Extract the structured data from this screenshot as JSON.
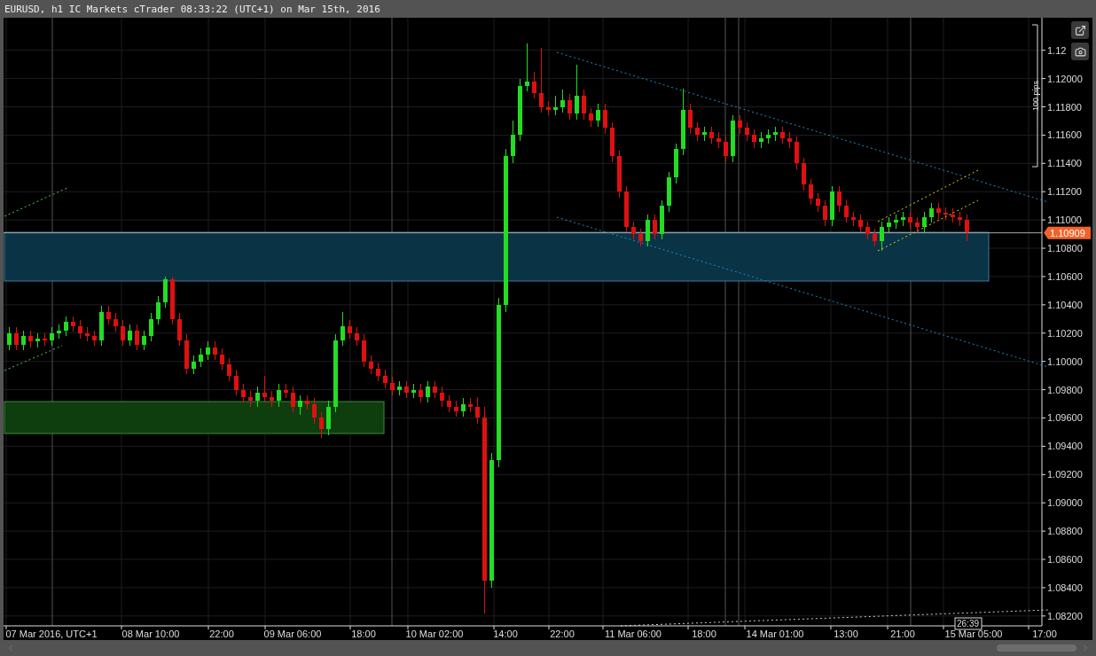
{
  "window": {
    "title": "EURUSD, h1 IC Markets cTrader 08:33:22 (UTC+1) on Mar 15th, 2016"
  },
  "current_price": "1.10909",
  "ruler": {
    "label": "100 pips"
  },
  "countdown": "26:39",
  "chart_data": {
    "type": "candlestick",
    "yticks": [
      {
        "value": 1.122,
        "label": "1.12"
      },
      {
        "value": 1.12,
        "label": "1.12000"
      },
      {
        "value": 1.118,
        "label": "1.11800"
      },
      {
        "value": 1.116,
        "label": "1.11600"
      },
      {
        "value": 1.114,
        "label": "1.11400"
      },
      {
        "value": 1.112,
        "label": "1.11200"
      },
      {
        "value": 1.11,
        "label": "1.11000"
      },
      {
        "value": 1.108,
        "label": "1.10800"
      },
      {
        "value": 1.106,
        "label": "1.10600"
      },
      {
        "value": 1.104,
        "label": "1.10400"
      },
      {
        "value": 1.102,
        "label": "1.10200"
      },
      {
        "value": 1.1,
        "label": "1.10000"
      },
      {
        "value": 1.098,
        "label": "1.09800"
      },
      {
        "value": 1.096,
        "label": "1.09600"
      },
      {
        "value": 1.094,
        "label": "1.09400"
      },
      {
        "value": 1.092,
        "label": "1.09200"
      },
      {
        "value": 1.09,
        "label": "1.09000"
      },
      {
        "value": 1.088,
        "label": "1.08800"
      },
      {
        "value": 1.086,
        "label": "1.08600"
      },
      {
        "value": 1.084,
        "label": "1.08400"
      },
      {
        "value": 1.082,
        "label": "1.08200"
      }
    ],
    "ylim": [
      1.0813,
      1.1243
    ],
    "grid": true,
    "ref_lines": [
      {
        "axis": "y",
        "value": 1.10909,
        "color": "#aaaaaa"
      }
    ],
    "categories": [
      null,
      null,
      null,
      null,
      null,
      null,
      "07 Mar 2016, UTC+1",
      null,
      null,
      null,
      null,
      null,
      null,
      null,
      null,
      null,
      null,
      null,
      null,
      null,
      "08 Mar 10:00",
      null,
      null,
      null,
      null,
      null,
      null,
      null,
      null,
      null,
      "22:00",
      null,
      null,
      null,
      null,
      null,
      null,
      null,
      null,
      null,
      "09 Mar 06:00",
      null,
      null,
      null,
      null,
      null,
      null,
      null,
      null,
      null,
      "18:00",
      null,
      null,
      null,
      null,
      null,
      null,
      null,
      null,
      null,
      "10 Mar 02:00",
      null,
      null,
      null,
      null,
      null,
      null,
      null,
      null,
      null,
      "14:00",
      null,
      null,
      null,
      null,
      null,
      null,
      null,
      "22:00",
      null,
      null,
      null,
      null,
      null,
      null,
      null,
      null,
      null,
      "11 Mar 06:00",
      null,
      null,
      null,
      null,
      null,
      null,
      null,
      null,
      null,
      "18:00",
      null,
      null,
      null,
      null,
      null,
      null,
      null,
      null,
      null,
      "14 Mar 01:00",
      null,
      null,
      null,
      null,
      null,
      null,
      null,
      null,
      null,
      "13:00",
      null,
      null,
      null,
      null,
      null,
      null,
      null,
      "21:00",
      null,
      null,
      null,
      null,
      null,
      null,
      null,
      null,
      null,
      "15 Mar 05:00",
      null,
      null,
      null,
      null,
      null,
      null,
      null,
      null,
      null,
      "17:00"
    ],
    "ohlc": [
      [
        1.1012,
        1.1024,
        1.1008,
        1.102
      ],
      [
        1.102,
        1.1024,
        1.1008,
        1.1012
      ],
      [
        1.1012,
        1.1022,
        1.1008,
        1.1018
      ],
      [
        1.1018,
        1.1022,
        1.101,
        1.1014
      ],
      [
        1.1014,
        1.102,
        1.101,
        1.1016
      ],
      [
        1.1016,
        1.102,
        1.1011,
        1.1015
      ],
      [
        1.1015,
        1.1024,
        1.1011,
        1.102
      ],
      [
        1.102,
        1.1026,
        1.1016,
        1.1022
      ],
      [
        1.1022,
        1.1032,
        1.1018,
        1.1028
      ],
      [
        1.1028,
        1.1032,
        1.1021,
        1.1025
      ],
      [
        1.1025,
        1.1029,
        1.1016,
        1.102
      ],
      [
        1.102,
        1.1024,
        1.1014,
        1.1018
      ],
      [
        1.1018,
        1.1022,
        1.1011,
        1.1015
      ],
      [
        1.1015,
        1.1039,
        1.1011,
        1.1035
      ],
      [
        1.1035,
        1.1039,
        1.1026,
        1.103
      ],
      [
        1.103,
        1.1034,
        1.1021,
        1.1025
      ],
      [
        1.1025,
        1.1029,
        1.1011,
        1.1015
      ],
      [
        1.1015,
        1.1026,
        1.1011,
        1.1022
      ],
      [
        1.1022,
        1.1026,
        1.1008,
        1.1012
      ],
      [
        1.1012,
        1.1022,
        1.1008,
        1.1018
      ],
      [
        1.1018,
        1.1034,
        1.1014,
        1.103
      ],
      [
        1.103,
        1.1046,
        1.1026,
        1.1042
      ],
      [
        1.1042,
        1.106,
        1.1038,
        1.1058
      ],
      [
        1.1058,
        1.106,
        1.1026,
        1.103
      ],
      [
        1.103,
        1.1034,
        1.1011,
        1.1015
      ],
      [
        1.1015,
        1.1019,
        1.0991,
        1.0995
      ],
      [
        1.0995,
        1.1004,
        1.0991,
        1.1
      ],
      [
        1.1,
        1.1009,
        1.0996,
        1.1005
      ],
      [
        1.1005,
        1.1014,
        1.1001,
        1.101
      ],
      [
        1.101,
        1.1014,
        1.1001,
        1.1005
      ],
      [
        1.1005,
        1.1009,
        1.0994,
        1.0998
      ],
      [
        1.0998,
        1.1002,
        1.0986,
        1.099
      ],
      [
        1.099,
        1.0994,
        1.0976,
        1.098
      ],
      [
        1.098,
        1.0984,
        1.0971,
        1.0975
      ],
      [
        1.0975,
        1.0979,
        1.0968,
        1.0972
      ],
      [
        1.0972,
        1.0982,
        1.0968,
        1.0978
      ],
      [
        1.0978,
        1.099,
        1.0971,
        1.0975
      ],
      [
        1.0975,
        1.0979,
        1.0968,
        1.0972
      ],
      [
        1.0972,
        1.0984,
        1.0968,
        1.098
      ],
      [
        1.098,
        1.0984,
        1.0974,
        1.0978
      ],
      [
        1.0978,
        1.0982,
        1.0964,
        1.0968
      ],
      [
        1.0968,
        1.0976,
        1.0962,
        1.0972
      ],
      [
        1.0972,
        1.0976,
        1.0966,
        1.097
      ],
      [
        1.097,
        1.0974,
        1.0956,
        1.096
      ],
      [
        1.096,
        1.0964,
        1.0946,
        1.0952
      ],
      [
        1.0952,
        1.0972,
        1.0948,
        1.0968
      ],
      [
        1.0968,
        1.1019,
        1.0964,
        1.1015
      ],
      [
        1.1015,
        1.1035,
        1.1011,
        1.1025
      ],
      [
        1.1025,
        1.1029,
        1.1016,
        1.102
      ],
      [
        1.102,
        1.1024,
        1.1011,
        1.1015
      ],
      [
        1.1015,
        1.1019,
        1.0996,
        1.1
      ],
      [
        1.1,
        1.1004,
        1.0991,
        1.0995
      ],
      [
        1.0995,
        1.0999,
        1.0986,
        1.099
      ],
      [
        1.099,
        1.0994,
        1.0981,
        1.0985
      ],
      [
        1.0985,
        1.0989,
        1.0976,
        1.098
      ],
      [
        1.098,
        1.0986,
        1.0976,
        1.0982
      ],
      [
        1.0982,
        1.0986,
        1.0974,
        1.0978
      ],
      [
        1.0978,
        1.0984,
        1.0974,
        1.098
      ],
      [
        1.098,
        1.0984,
        1.0971,
        1.0975
      ],
      [
        1.0975,
        1.0986,
        1.0971,
        1.0982
      ],
      [
        1.0982,
        1.0986,
        1.0974,
        1.0978
      ],
      [
        1.0978,
        1.0982,
        1.0968,
        1.0972
      ],
      [
        1.0972,
        1.0976,
        1.0964,
        1.0968
      ],
      [
        1.0968,
        1.0972,
        1.0961,
        1.0965
      ],
      [
        1.0965,
        1.0974,
        1.0961,
        1.097
      ],
      [
        1.097,
        1.0974,
        1.0964,
        1.0968
      ],
      [
        1.0968,
        1.0975,
        1.0956,
        1.096
      ],
      [
        1.096,
        1.0968,
        1.0822,
        1.0845
      ],
      [
        1.0845,
        1.0935,
        1.084,
        1.093
      ],
      [
        1.093,
        1.1045,
        1.0925,
        1.104
      ],
      [
        1.104,
        1.115,
        1.1035,
        1.1145
      ],
      [
        1.1145,
        1.117,
        1.114,
        1.116
      ],
      [
        1.116,
        1.12,
        1.1156,
        1.1195
      ],
      [
        1.1195,
        1.1225,
        1.1191,
        1.1198
      ],
      [
        1.1198,
        1.1205,
        1.1186,
        1.119
      ],
      [
        1.119,
        1.1222,
        1.1176,
        1.118
      ],
      [
        1.118,
        1.1184,
        1.1174,
        1.1178
      ],
      [
        1.1178,
        1.1188,
        1.1174,
        1.118
      ],
      [
        1.118,
        1.1192,
        1.1176,
        1.1185
      ],
      [
        1.1185,
        1.1189,
        1.1171,
        1.1175
      ],
      [
        1.1175,
        1.121,
        1.1171,
        1.1188
      ],
      [
        1.1188,
        1.1192,
        1.1171,
        1.1175
      ],
      [
        1.1175,
        1.1179,
        1.1166,
        1.117
      ],
      [
        1.117,
        1.1182,
        1.1166,
        1.1178
      ],
      [
        1.1178,
        1.1182,
        1.1161,
        1.1165
      ],
      [
        1.1165,
        1.1169,
        1.1141,
        1.1145
      ],
      [
        1.1145,
        1.1149,
        1.1116,
        1.112
      ],
      [
        1.112,
        1.1124,
        1.1091,
        1.1095
      ],
      [
        1.1095,
        1.1099,
        1.1086,
        1.109
      ],
      [
        1.109,
        1.1094,
        1.1081,
        1.1085
      ],
      [
        1.1085,
        1.1104,
        1.1081,
        1.11
      ],
      [
        1.11,
        1.1104,
        1.1086,
        1.109
      ],
      [
        1.109,
        1.1114,
        1.1086,
        1.111
      ],
      [
        1.111,
        1.1134,
        1.1106,
        1.113
      ],
      [
        1.113,
        1.1154,
        1.1126,
        1.115
      ],
      [
        1.115,
        1.1193,
        1.1146,
        1.1178
      ],
      [
        1.1178,
        1.1182,
        1.1161,
        1.1165
      ],
      [
        1.1165,
        1.1169,
        1.1156,
        1.116
      ],
      [
        1.116,
        1.1166,
        1.1156,
        1.1162
      ],
      [
        1.1162,
        1.1166,
        1.1154,
        1.1158
      ],
      [
        1.1158,
        1.1162,
        1.1151,
        1.1155
      ],
      [
        1.1155,
        1.1159,
        1.1141,
        1.1145
      ],
      [
        1.1145,
        1.1174,
        1.1141,
        1.117
      ],
      [
        1.117,
        1.1174,
        1.1161,
        1.1165
      ],
      [
        1.1165,
        1.1169,
        1.1156,
        1.116
      ],
      [
        1.116,
        1.1164,
        1.1151,
        1.1155
      ],
      [
        1.1155,
        1.1162,
        1.1151,
        1.1158
      ],
      [
        1.1158,
        1.1164,
        1.1154,
        1.116
      ],
      [
        1.116,
        1.1166,
        1.1156,
        1.1162
      ],
      [
        1.1162,
        1.1166,
        1.1154,
        1.1158
      ],
      [
        1.1158,
        1.1162,
        1.1151,
        1.1155
      ],
      [
        1.1155,
        1.1159,
        1.1136,
        1.114
      ],
      [
        1.114,
        1.1144,
        1.1121,
        1.1125
      ],
      [
        1.1125,
        1.1129,
        1.1111,
        1.1115
      ],
      [
        1.1115,
        1.1119,
        1.1106,
        1.111
      ],
      [
        1.111,
        1.1114,
        1.1096,
        1.11
      ],
      [
        1.11,
        1.1124,
        1.1096,
        1.112
      ],
      [
        1.112,
        1.1124,
        1.1106,
        1.111
      ],
      [
        1.111,
        1.1114,
        1.1098,
        1.1102
      ],
      [
        1.1102,
        1.1106,
        1.1096,
        1.11
      ],
      [
        1.11,
        1.1104,
        1.1091,
        1.1095
      ],
      [
        1.1095,
        1.1099,
        1.1086,
        1.109
      ],
      [
        1.109,
        1.1094,
        1.1081,
        1.1085
      ],
      [
        1.1085,
        1.1099,
        1.1078,
        1.1095
      ],
      [
        1.1095,
        1.1102,
        1.1091,
        1.1098
      ],
      [
        1.1098,
        1.1104,
        1.1094,
        1.11
      ],
      [
        1.11,
        1.1106,
        1.1096,
        1.1102
      ],
      [
        1.1102,
        1.1106,
        1.1094,
        1.1098
      ],
      [
        1.1098,
        1.1102,
        1.1091,
        1.1095
      ],
      [
        1.1095,
        1.1106,
        1.1091,
        1.1102
      ],
      [
        1.1102,
        1.1112,
        1.1098,
        1.1108
      ],
      [
        1.1108,
        1.1112,
        1.1101,
        1.1105
      ],
      [
        1.1105,
        1.1109,
        1.11,
        1.1104
      ],
      [
        1.1104,
        1.1108,
        1.1098,
        1.1102
      ],
      [
        1.1102,
        1.1106,
        1.1096,
        1.11
      ],
      [
        1.11,
        1.1104,
        1.1085,
        1.1091
      ],
      null,
      null,
      null,
      null,
      null,
      null,
      null,
      null,
      null,
      null,
      null
    ]
  }
}
